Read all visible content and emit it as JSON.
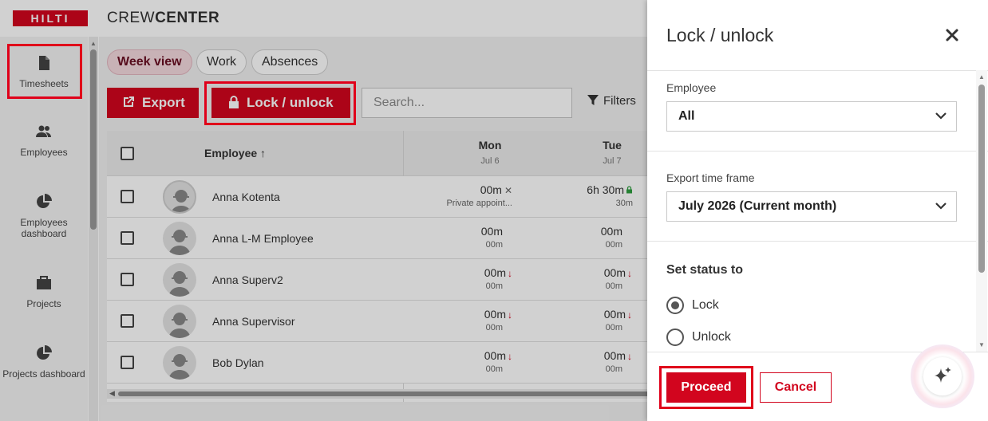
{
  "app": {
    "logo_text": "HILTI",
    "brand_light": "CREW",
    "brand_bold": "CENTER"
  },
  "sidebar": {
    "items": [
      {
        "label": "Timesheets",
        "icon": "document-icon"
      },
      {
        "label": "Employees",
        "icon": "people-icon"
      },
      {
        "label": "Employees dashboard",
        "icon": "pie-chart-icon"
      },
      {
        "label": "Projects",
        "icon": "briefcase-icon"
      },
      {
        "label": "Projects dashboard",
        "icon": "pie-chart-icon"
      }
    ]
  },
  "main": {
    "tabs": [
      {
        "label": "Week view",
        "active": true
      },
      {
        "label": "Work",
        "active": false
      },
      {
        "label": "Absences",
        "active": false
      }
    ],
    "export_label": "Export",
    "lock_label": "Lock / unlock",
    "search_placeholder": "Search...",
    "filters_label": "Filters",
    "table": {
      "employee_header": "Employee",
      "days": [
        {
          "day": "Mon",
          "date": "Jul 6"
        },
        {
          "day": "Tue",
          "date": "Jul 7"
        }
      ],
      "rows": [
        {
          "name": "Anna Kotenta",
          "mon": "00m",
          "mon_sub": "Private appoint...",
          "mon_mark": "x",
          "tue": "6h 30m",
          "tue_sub": "30m",
          "tue_mark": "lock"
        },
        {
          "name": "Anna L-M Employee",
          "mon": "00m",
          "mon_sub": "00m",
          "mon_mark": "",
          "tue": "00m",
          "tue_sub": "00m",
          "tue_mark": ""
        },
        {
          "name": "Anna Superv2",
          "mon": "00m",
          "mon_sub": "00m",
          "mon_mark": "down",
          "tue": "00m",
          "tue_sub": "00m",
          "tue_mark": "down"
        },
        {
          "name": "Anna Supervisor",
          "mon": "00m",
          "mon_sub": "00m",
          "mon_mark": "down",
          "tue": "00m",
          "tue_sub": "00m",
          "tue_mark": "down"
        },
        {
          "name": "Bob Dylan",
          "mon": "00m",
          "mon_sub": "00m",
          "mon_mark": "down",
          "tue": "00m",
          "tue_sub": "00m",
          "tue_mark": "down"
        }
      ]
    }
  },
  "panel": {
    "title": "Lock / unlock",
    "employee_label": "Employee",
    "employee_value": "All",
    "timeframe_label": "Export time frame",
    "timeframe_value": "July 2026 (Current month)",
    "status_heading": "Set status to",
    "options": [
      {
        "label": "Lock",
        "selected": true
      },
      {
        "label": "Unlock",
        "selected": false
      }
    ],
    "proceed_label": "Proceed",
    "cancel_label": "Cancel"
  },
  "colors": {
    "brand_red": "#d2051e",
    "highlight_red": "#e0001a",
    "active_chip_bg": "#f4d9df"
  }
}
